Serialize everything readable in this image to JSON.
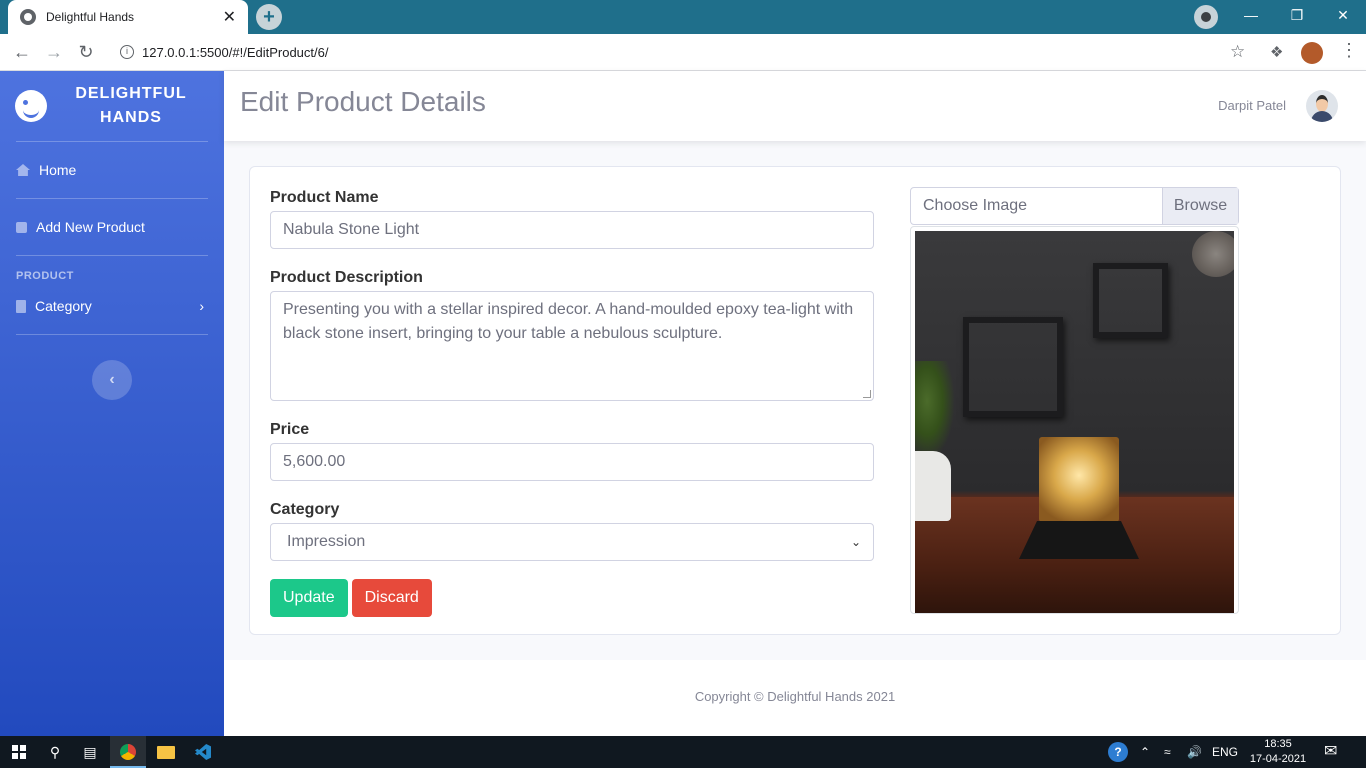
{
  "browser": {
    "tab_title": "Delightful Hands",
    "tab_close": "✕",
    "new_tab": "+",
    "url": "127.0.0.1:5500/#!/EditProduct/6/"
  },
  "sidebar": {
    "brand_line1": "DELIGHTFUL",
    "brand_line2": "HANDS",
    "items": [
      {
        "label": "Home"
      },
      {
        "label": "Add New Product"
      }
    ],
    "heading": "PRODUCT",
    "category_label": "Category"
  },
  "topbar": {
    "page_title": "Edit Product Details",
    "user_name": "Darpit Patel"
  },
  "form": {
    "name_label": "Product Name",
    "name_value": "Nabula Stone Light",
    "description_label": "Product Description",
    "description_value": "Presenting you with a stellar inspired decor. A hand-moulded epoxy tea-light with black stone insert, bringing to your table a nebulous sculpture.",
    "price_label": "Price",
    "price_value": "5,600.00",
    "category_label": "Category",
    "category_value": "Impression",
    "update_label": "Update",
    "discard_label": "Discard",
    "file_placeholder": "Choose Image",
    "browse_label": "Browse"
  },
  "footer": {
    "text": "Copyright © Delightful Hands 2021"
  },
  "taskbar": {
    "language": "ENG",
    "time": "18:35",
    "date": "17-04-2021"
  },
  "colors": {
    "sidebar_top": "#4e73df",
    "sidebar_bottom": "#224abe",
    "update_button": "#1cc88a",
    "discard_button": "#e74a3b",
    "chrome_tabbar": "#1f6f8b"
  }
}
